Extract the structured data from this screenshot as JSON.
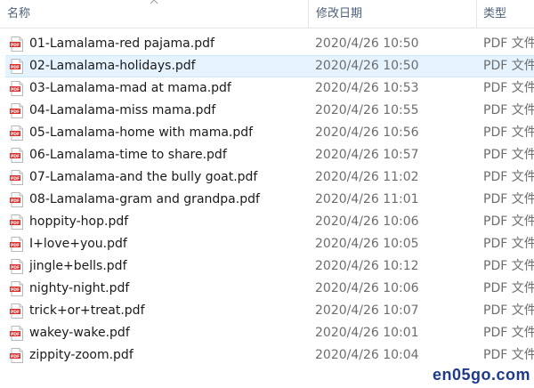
{
  "header": {
    "name_label": "名称",
    "date_label": "修改日期",
    "type_label": "类型"
  },
  "files": [
    {
      "name": "01-Lamalama-red pajama.pdf",
      "date": "2020/4/26 10:50",
      "type": "PDF 文件",
      "selected": false
    },
    {
      "name": "02-Lamalama-holidays.pdf",
      "date": "2020/4/26 10:50",
      "type": "PDF 文件",
      "selected": true
    },
    {
      "name": "03-Lamalama-mad at mama.pdf",
      "date": "2020/4/26 10:53",
      "type": "PDF 文件",
      "selected": false
    },
    {
      "name": "04-Lamalama-miss mama.pdf",
      "date": "2020/4/26 10:55",
      "type": "PDF 文件",
      "selected": false
    },
    {
      "name": "05-Lamalama-home with mama.pdf",
      "date": "2020/4/26 10:56",
      "type": "PDF 文件",
      "selected": false
    },
    {
      "name": "06-Lamalama-time to share.pdf",
      "date": "2020/4/26 10:57",
      "type": "PDF 文件",
      "selected": false
    },
    {
      "name": "07-Lamalama-and the bully goat.pdf",
      "date": "2020/4/26 11:02",
      "type": "PDF 文件",
      "selected": false
    },
    {
      "name": "08-Lamalama-gram and grandpa.pdf",
      "date": "2020/4/26 11:01",
      "type": "PDF 文件",
      "selected": false
    },
    {
      "name": "hoppity-hop.pdf",
      "date": "2020/4/26 10:06",
      "type": "PDF 文件",
      "selected": false
    },
    {
      "name": "I+love+you.pdf",
      "date": "2020/4/26 10:05",
      "type": "PDF 文件",
      "selected": false
    },
    {
      "name": "jingle+bells.pdf",
      "date": "2020/4/26 10:12",
      "type": "PDF 文件",
      "selected": false
    },
    {
      "name": "nighty-night.pdf",
      "date": "2020/4/26 10:06",
      "type": "PDF 文件",
      "selected": false
    },
    {
      "name": "trick+or+treat.pdf",
      "date": "2020/4/26 10:07",
      "type": "PDF 文件",
      "selected": false
    },
    {
      "name": "wakey-wake.pdf",
      "date": "2020/4/26 10:01",
      "type": "PDF 文件",
      "selected": false
    },
    {
      "name": "zippity-zoom.pdf",
      "date": "2020/4/26 10:04",
      "type": "PDF 文件",
      "selected": false
    }
  ],
  "icons": {
    "file": "pdf-file-icon",
    "sort": "sort-ascending-icon"
  },
  "watermark": "en05go.com",
  "colors": {
    "selection_bg": "#e5f3ff",
    "selection_border": "#cce8ff",
    "pdf_red": "#d9302c",
    "header_text": "#4c607a"
  }
}
